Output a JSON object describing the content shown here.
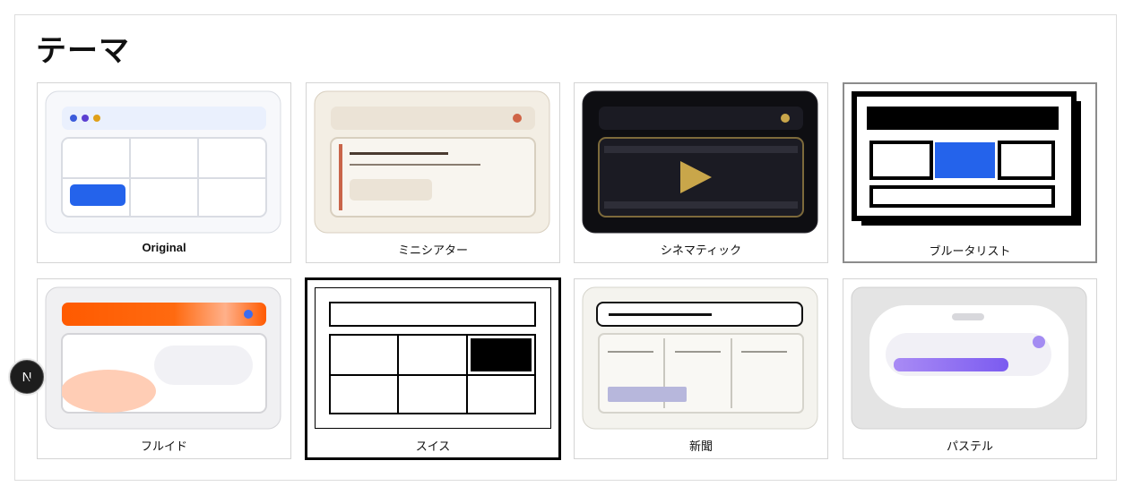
{
  "page": {
    "title": "テーマ"
  },
  "themes": [
    {
      "label": "Original",
      "icon": "theme-original-preview"
    },
    {
      "label": "ミニシアター",
      "icon": "theme-mini-theater-preview"
    },
    {
      "label": "シネマティック",
      "icon": "theme-cinematic-preview"
    },
    {
      "label": "ブルータリスト",
      "icon": "theme-brutalist-preview"
    },
    {
      "label": "フルイド",
      "icon": "theme-fluid-preview"
    },
    {
      "label": "スイス",
      "icon": "theme-swiss-preview"
    },
    {
      "label": "新聞",
      "icon": "theme-newspaper-preview"
    },
    {
      "label": "パステル",
      "icon": "theme-pastel-preview"
    }
  ],
  "fab": {
    "text": "N",
    "icon": "next-logo-icon"
  },
  "colors": {
    "accent_blue": "#2463eb",
    "cinematic_gold": "#c9a64a",
    "fluid_orange": "#ff5a00",
    "pastel_purple": "#9b7bf0"
  }
}
